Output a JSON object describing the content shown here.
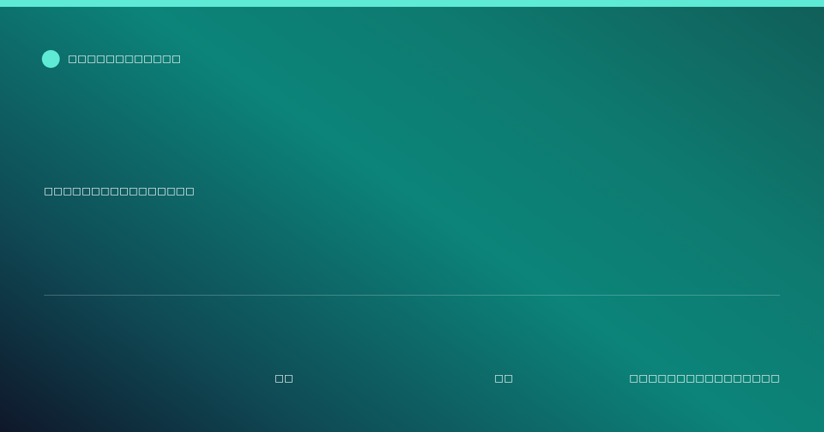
{
  "colors": {
    "accent": "#5eead4"
  },
  "brand": {
    "icon": "circle-dot-icon",
    "name": "□□□□□□□□□□□□"
  },
  "headline": "□□□□□□□□□□□□□□□□",
  "footer": {
    "item_1": "□□",
    "item_2": "□□",
    "item_3": "□□□□□□□□□□□□□□□□"
  }
}
